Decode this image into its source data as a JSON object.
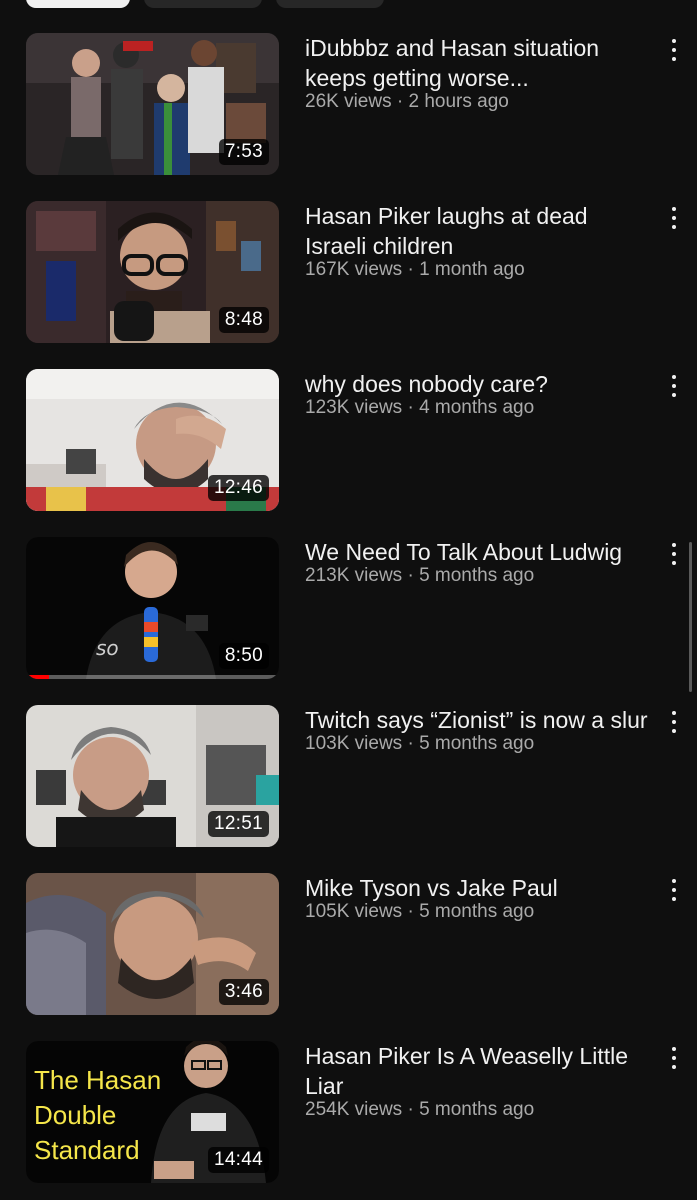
{
  "chips": [
    "",
    "",
    ""
  ],
  "videos": [
    {
      "title": "iDubbbz and Hasan situation keeps getting worse...",
      "views": "26K views",
      "age": "2 hours ago",
      "duration": "7:53",
      "thumb_icon": "three-people-standing-thumbnail"
    },
    {
      "title": "Hasan Piker laughs at dead Israeli children",
      "views": "167K views",
      "age": "1 month ago",
      "duration": "8:48",
      "thumb_icon": "streamer-with-microphone-thumbnail"
    },
    {
      "title": "why does nobody care?",
      "views": "123K views",
      "age": "4 months ago",
      "duration": "12:46",
      "thumb_icon": "man-hand-on-forehead-thumbnail"
    },
    {
      "title": "We Need To Talk About Ludwig",
      "views": "213K views",
      "age": "5 months ago",
      "duration": "8:50",
      "progress": 0.09,
      "thumb_icon": "streamer-dark-background-thumbnail"
    },
    {
      "title": "Twitch says “Zionist” is now a slur",
      "views": "103K views",
      "age": "5 months ago",
      "duration": "12:51",
      "thumb_icon": "man-in-gym-room-thumbnail"
    },
    {
      "title": "Mike Tyson vs Jake Paul",
      "views": "105K views",
      "age": "5 months ago",
      "duration": "3:46",
      "thumb_icon": "man-on-couch-thumbnail"
    },
    {
      "title": "Hasan Piker Is A Weaselly Little Liar",
      "views": "254K views",
      "age": "5 months ago",
      "duration": "14:44",
      "thumb_text": [
        "The Hasan",
        "Double",
        "Standard"
      ],
      "thumb_icon": "yellow-text-man-thumbnail"
    }
  ],
  "meta_separator": " · ",
  "colors": {
    "background": "#0f0f0f",
    "title": "#f1f1f1",
    "meta": "#aaaaaa",
    "progress": "#ff0000",
    "thumb_yellow_text": "#f5e64a"
  }
}
